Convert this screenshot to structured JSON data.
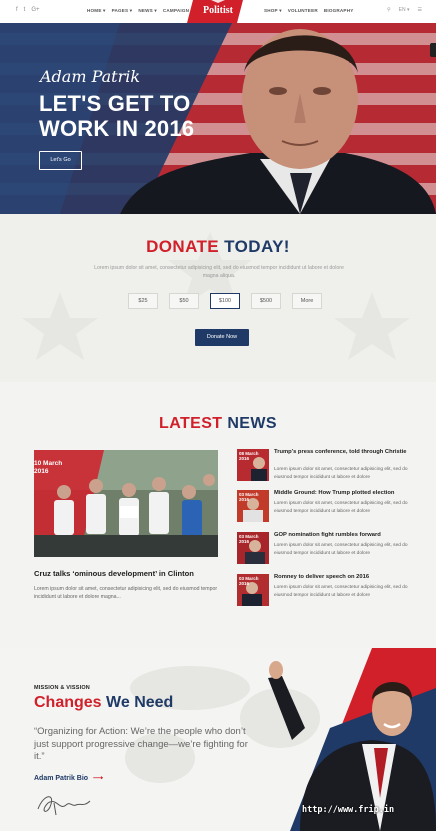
{
  "header": {
    "social": [
      "f",
      "t",
      "G+"
    ],
    "nav_left": [
      "HOME ▾",
      "PAGES ▾",
      "NEWS ▾",
      "CAMPAIGN"
    ],
    "logo": "Politist",
    "nav_right": [
      "SHOP ▾",
      "VOLUNTEER",
      "BIOGRAPHY"
    ],
    "tools": [
      "⚲",
      "EN ▾",
      "☰"
    ]
  },
  "hero": {
    "script_name": "Adam Patrik",
    "title": "LET'S GET TO WORK IN 2016",
    "button": "Let's Go"
  },
  "donate": {
    "title_red": "DONATE",
    "title_navy": "TODAY!",
    "text": "Lorem ipsum dolor sit amet, consectetur adipisicing elit, sed do eiusmod tempor incididunt ut labore et dolore magna aliqua.",
    "amounts": [
      "$25",
      "$50",
      "$100",
      "$500",
      "More"
    ],
    "selected": "$100",
    "button": "Donate Now"
  },
  "news": {
    "title_red": "LATEST",
    "title_navy": "NEWS",
    "main": {
      "date": "10 March 2016",
      "headline": "Cruz talks ‘ominous development’ in Clinton",
      "excerpt": "Lorem ipsum dolor sit amet, consectetur adipisicing elit, sed do eiusmod tempor incididunt ut labore et dolore magna..."
    },
    "items": [
      {
        "date": "08 March 2016",
        "title": "Trump's press conference, told through Christie",
        "text": "Lorem ipsum dolor sit amet, consectetur adipisicing elit, sed do eiusmod tempor incididunt ut labore et dolore"
      },
      {
        "date": "03 March 2016",
        "title": "Middle Ground: How Trump plotted election",
        "text": "Lorem ipsum dolor sit amet, consectetur adipisicing elit, sed do eiusmod tempor incididunt ut labore et dolore"
      },
      {
        "date": "03 March 2016",
        "title": "GOP nomination fight rumbles forward",
        "text": "Lorem ipsum dolor sit amet, consectetur adipisicing elit, sed do eiusmod tempor incididunt ut labore et dolore"
      },
      {
        "date": "03 March 2016",
        "title": "Romney to deliver speech on 2016",
        "text": "Lorem ipsum dolor sit amet, consectetur adipisicing elit, sed do eiusmod tempor incididunt ut labore et dolore"
      }
    ]
  },
  "mission": {
    "label": "MISSION & VISSION",
    "title_red": "Changes",
    "title_navy": "We Need",
    "quote": "“Organizing for Action: We’re the people who don’t just support progressive change—we’re fighting for it.”",
    "bio_link": "Adam Patrik Bio",
    "arrow": "⟶"
  },
  "watermark": "http://www.frip.in",
  "colors": {
    "red": "#d1202a",
    "navy": "#1f3a66"
  }
}
